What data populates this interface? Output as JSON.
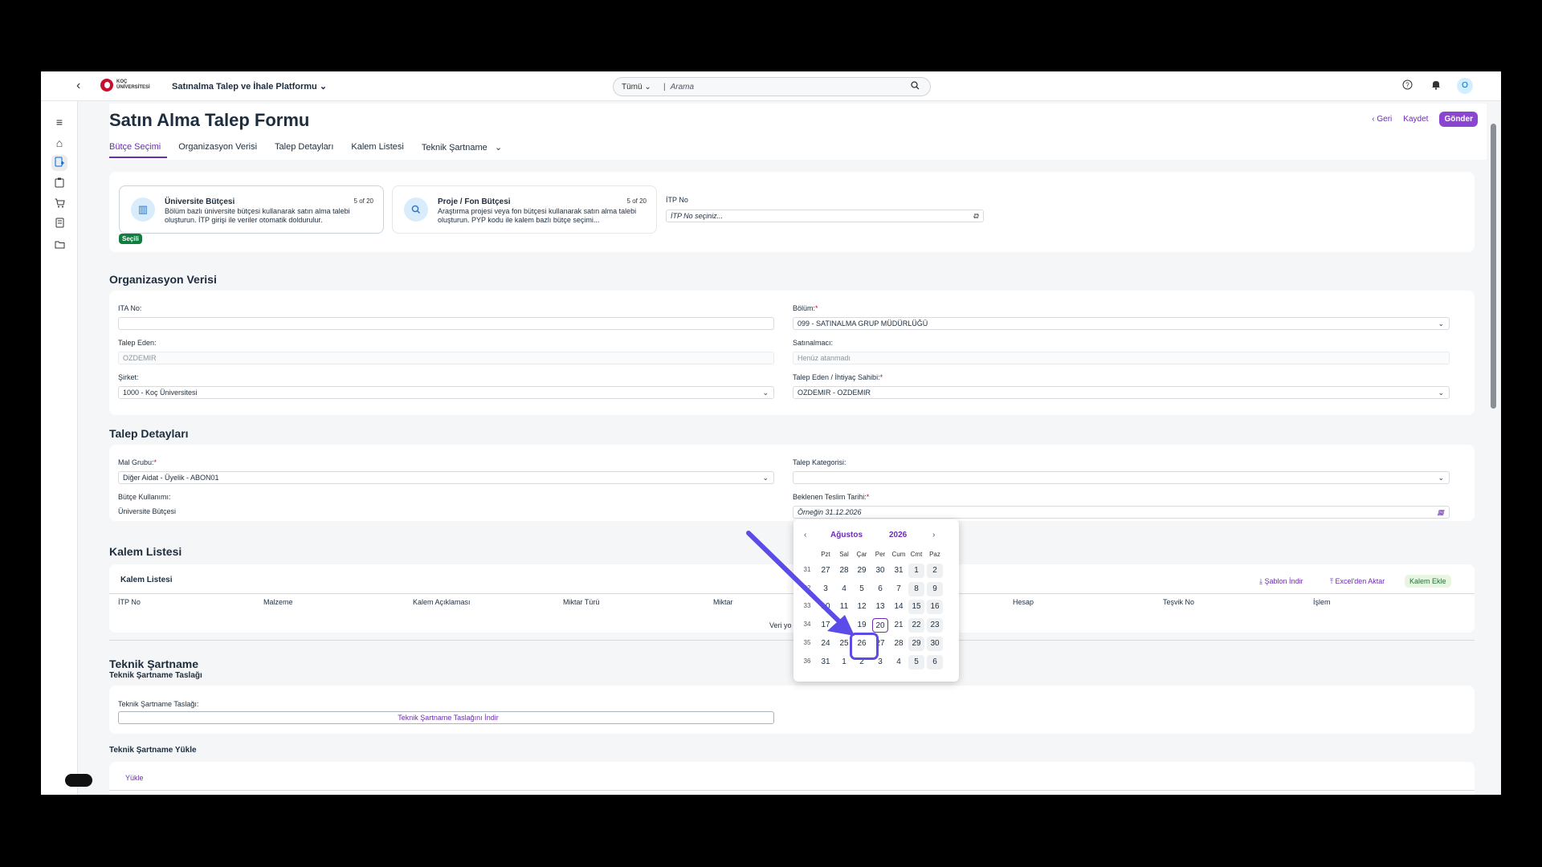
{
  "shell": {
    "logo_text_1": "KOÇ",
    "logo_text_2": "ÜNİVERSİTESİ",
    "platform": "Satınalma Talep ve İhale Platformu",
    "search_scope": "Tümü",
    "search_placeholder": "Arama",
    "avatar": "O"
  },
  "header": {
    "title": "Satın Alma Talep Formu",
    "tabs": [
      "Bütçe Seçimi",
      "Organizasyon Verisi",
      "Talep Detayları",
      "Kalem Listesi",
      "Teknik Şartname"
    ],
    "back": "Geri",
    "save": "Kaydet",
    "send": "Gönder"
  },
  "budget": {
    "univ_title": "Üniversite Bütçesi",
    "univ_count": "5 of 20",
    "univ_desc": "Bölüm bazlı üniversite bütçesi kullanarak satın alma talebi oluşturun. İTP girişi ile veriler otomatik doldurulur.",
    "proj_title": "Proje / Fon Bütçesi",
    "proj_count": "5 of 20",
    "proj_desc": "Araştırma projesi veya fon bütçesi kullanarak satın alma talebi oluşturun. PYP kodu ile kalem bazlı bütçe seçimi...",
    "selected_badge": "Seçili",
    "itp_label": "İTP No",
    "itp_placeholder": "İTP No seçiniz..."
  },
  "org": {
    "title": "Organizasyon Verisi",
    "ita_label": "ITA No:",
    "bolum_label": "Bölüm:",
    "bolum_value": "099 - SATINALMA GRUP MÜDÜRLÜĞÜ",
    "talep_eden_label": "Talep Eden:",
    "talep_eden_value": "OZDEMIR",
    "satinalmaci_label": "Satınalmacı:",
    "satinalmaci_value": "Henüz atanmadı",
    "sirket_label": "Şirket:",
    "sirket_value": "1000 - Koç Üniversitesi",
    "sahip_label": "Talep Eden / İhtiyaç Sahibi:",
    "sahip_value": "OZDEMIR - OZDEMIR"
  },
  "talep": {
    "title": "Talep Detayları",
    "mal_label": "Mal Grubu:",
    "mal_value": "Diğer Aidat - Üyelik - ABON01",
    "kategori_label": "Talep Kategorisi:",
    "butce_label": "Bütçe Kullanımı:",
    "butce_value": "Üniversite Bütçesi",
    "teslim_label": "Beklenen Teslim Tarihi:",
    "teslim_placeholder": "Örneğin 31.12.2026"
  },
  "kalem": {
    "title": "Kalem Listesi",
    "card_title": "Kalem Listesi",
    "sablon": "Şablon İndir",
    "excel": "Excel'den Aktar",
    "ekle": "Kalem Ekle",
    "columns": [
      "İTP No",
      "Malzeme",
      "Kalem Açıklaması",
      "Miktar Türü",
      "Miktar",
      "Hesap",
      "Teşvik No",
      "İşlem"
    ],
    "empty": "Veri yo"
  },
  "teknik": {
    "title": "Teknik Şartname",
    "taslak_title": "Teknik Şartname Taslağı",
    "taslak_label": "Teknik Şartname Taslağı:",
    "taslak_link": "Teknik Şartname Taslağını İndir",
    "yukle_title": "Teknik Şartname Yükle",
    "yukle_tab": "Yükle"
  },
  "calendar": {
    "month": "Ağustos",
    "year": "2026",
    "weekdays": [
      "Pzt",
      "Sal",
      "Çar",
      "Per",
      "Cum",
      "Cmt",
      "Paz"
    ],
    "weeks": [
      {
        "no": "31",
        "days": [
          "27",
          "28",
          "29",
          "30",
          "31",
          "1",
          "2"
        ]
      },
      {
        "no": "32",
        "days": [
          "3",
          "4",
          "5",
          "6",
          "7",
          "8",
          "9"
        ]
      },
      {
        "no": "33",
        "days": [
          "10",
          "11",
          "12",
          "13",
          "14",
          "15",
          "16"
        ]
      },
      {
        "no": "34",
        "days": [
          "17",
          "18",
          "19",
          "20",
          "21",
          "22",
          "23"
        ]
      },
      {
        "no": "35",
        "days": [
          "24",
          "25",
          "26",
          "27",
          "28",
          "29",
          "30"
        ]
      },
      {
        "no": "36",
        "days": [
          "31",
          "1",
          "2",
          "3",
          "4",
          "5",
          "6"
        ]
      }
    ],
    "today": "20",
    "highlighted": "26"
  },
  "colors": {
    "accent": "#6a2cb0",
    "highlight": "#5b4be8",
    "badge": "#107e3e"
  }
}
